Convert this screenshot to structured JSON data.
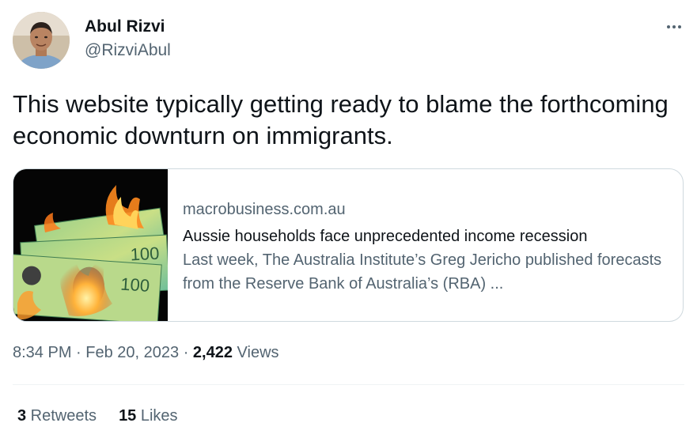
{
  "colors": {
    "text_primary": "#0f1419",
    "text_secondary": "#536471",
    "border": "#cfd9de",
    "divider": "#eff3f4"
  },
  "author": {
    "name": "Abul Rizvi",
    "handle": "@RizviAbul",
    "avatar_icon": "profile-photo"
  },
  "more_icon": "more-horizontal-icon",
  "tweet": {
    "text": "This website typically getting ready to blame the forthcoming economic downturn on immigrants."
  },
  "card": {
    "domain": "macrobusiness.com.au",
    "title": "Aussie households face unprecedented income recession",
    "description": "Last week, The Australia Institute’s Greg Jericho published forecasts from the Reserve Bank of Australia’s (RBA) ...",
    "thumbnail_icon": "burning-banknotes-image"
  },
  "meta": {
    "time": "8:34 PM",
    "sep1": " · ",
    "date": "Feb 20, 2023",
    "sep2": " · ",
    "views_count": "2,422",
    "views_label": " Views"
  },
  "stats": {
    "retweets_count": "3",
    "retweets_label": " Retweets",
    "likes_count": "15",
    "likes_label": " Likes"
  }
}
